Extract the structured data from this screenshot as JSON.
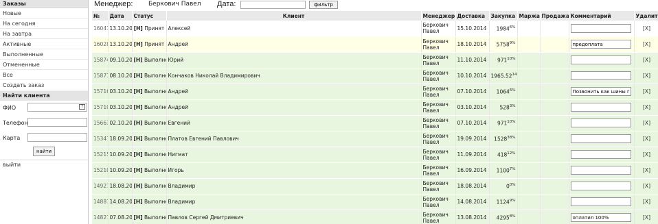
{
  "sidebar": {
    "orders_header": "Заказы",
    "items": [
      {
        "label": "Новые"
      },
      {
        "label": "На сегодня"
      },
      {
        "label": "На завтра"
      },
      {
        "label": "Активные"
      },
      {
        "label": "Выполненные"
      },
      {
        "label": "Отмененные"
      },
      {
        "label": "Все"
      },
      {
        "label": "Создать заказ"
      }
    ],
    "find_header": "Найти клиента",
    "fio_label": "ФИО",
    "fio_badge": "?",
    "phone_label": "Телефон",
    "card_label": "Карта",
    "find_button": "найти",
    "logout": "выйти"
  },
  "filter": {
    "manager_label": "Менеджер:",
    "manager_value": "Беркович Павел",
    "date_label": "Дата:",
    "date_value": "",
    "button": "фильтр"
  },
  "table": {
    "headers": [
      "№",
      "Дата",
      "Статус",
      "Клиент",
      "Менеджер",
      "Доставка",
      "Закупка",
      "Маржа",
      "Продажа",
      "Комментарий",
      "Удалить"
    ],
    "rows": [
      {
        "num": "16041",
        "date": "13.10.2014",
        "code": "[Н]",
        "status": "Принят",
        "client": "Алексей",
        "mgr1": "Беркович",
        "mgr2": "Павел",
        "delivery": "15.10.2014",
        "buy": "1984",
        "margin": "6%",
        "comment": "",
        "del": "[X]",
        "style": "white"
      },
      {
        "num": "16028",
        "date": "13.10.2014",
        "code": "[Н]",
        "status": "Принят",
        "client": "Андрей",
        "mgr1": "Беркович",
        "mgr2": "Павел",
        "delivery": "18.10.2014",
        "buy": "5758",
        "margin": "9%",
        "comment": "предоплата",
        "del": "[X]",
        "style": "yellow"
      },
      {
        "num": "15874",
        "date": "09.10.2014",
        "code": "[Н]",
        "status": "Выполнен",
        "client": "Юрий",
        "mgr1": "Беркович",
        "mgr2": "Павел",
        "delivery": "11.10.2014",
        "buy": "971",
        "margin": "10%",
        "comment": "",
        "del": "[X]",
        "style": "green"
      },
      {
        "num": "15871",
        "date": "08.10.2014",
        "code": "[Н]",
        "status": "Выполнен",
        "client": "Кончаков Николай Владимирович",
        "mgr1": "Беркович",
        "mgr2": "Павел",
        "delivery": "10.10.2014",
        "buy": "1965.52",
        "margin": "14%",
        "comment": "",
        "del": "[X]",
        "style": "green"
      },
      {
        "num": "15716",
        "date": "03.10.2014",
        "code": "[Н]",
        "status": "Выполнен",
        "client": "Андрей",
        "mgr1": "Беркович",
        "mgr2": "Павел",
        "delivery": "07.10.2014",
        "buy": "1064",
        "margin": "6%",
        "comment": "Позвонить как шины пос",
        "del": "[X]",
        "style": "green"
      },
      {
        "num": "15710",
        "date": "03.10.2014",
        "code": "[Н]",
        "status": "Выполнен",
        "client": "Андрей",
        "mgr1": "Беркович",
        "mgr2": "Павел",
        "delivery": "03.10.2014",
        "buy": "528",
        "margin": "3%",
        "comment": "",
        "del": "[X]",
        "style": "green"
      },
      {
        "num": "15663",
        "date": "02.10.2014",
        "code": "[Н]",
        "status": "Выполнен",
        "client": "Евгений",
        "mgr1": "Беркович",
        "mgr2": "Павел",
        "delivery": "07.10.2014",
        "buy": "971",
        "margin": "10%",
        "comment": "",
        "del": "[X]",
        "style": "green"
      },
      {
        "num": "15347",
        "date": "18.09.2014",
        "code": "[Н]",
        "status": "Выполнен",
        "client": "Платов Евгений Павлович",
        "mgr1": "Беркович",
        "mgr2": "Павел",
        "delivery": "19.09.2014",
        "buy": "1528",
        "margin": "38%",
        "comment": "",
        "del": "[X]",
        "style": "green"
      },
      {
        "num": "15215",
        "date": "10.09.2014",
        "code": "[Н]",
        "status": "Выполнен",
        "client": "Нигмат",
        "mgr1": "Беркович",
        "mgr2": "Павел",
        "delivery": "11.09.2014",
        "buy": "418",
        "margin": "12%",
        "comment": "",
        "del": "[X]",
        "style": "green"
      },
      {
        "num": "15210",
        "date": "10.09.2014",
        "code": "[Н]",
        "status": "Выполнен",
        "client": "Игорь",
        "mgr1": "Беркович",
        "mgr2": "Павел",
        "delivery": "16.09.2014",
        "buy": "1100",
        "margin": "7%",
        "comment": "",
        "del": "[X]",
        "style": "green"
      },
      {
        "num": "14927",
        "date": "18.08.2014",
        "code": "[Н]",
        "status": "Выполнен",
        "client": "Владимир",
        "mgr1": "Беркович",
        "mgr2": "Павел",
        "delivery": "18.08.2014",
        "buy": "0",
        "margin": "0%",
        "comment": "",
        "del": "[X]",
        "style": "green"
      },
      {
        "num": "14887",
        "date": "14.08.2014",
        "code": "[Н]",
        "status": "Выполнен",
        "client": "Владимир",
        "mgr1": "Беркович",
        "mgr2": "Павел",
        "delivery": "14.08.2014",
        "buy": "1124",
        "margin": "9%",
        "comment": "",
        "del": "[X]",
        "style": "green"
      },
      {
        "num": "14827",
        "date": "07.08.2014",
        "code": "[Н]",
        "status": "Выполнен",
        "client": "Павлов Сергей Дмитриевич",
        "mgr1": "Беркович",
        "mgr2": "Павел",
        "delivery": "13.08.2014",
        "buy": "4295",
        "margin": "8%",
        "comment": "оплатил 100%",
        "del": "[X]",
        "style": "green"
      }
    ]
  }
}
